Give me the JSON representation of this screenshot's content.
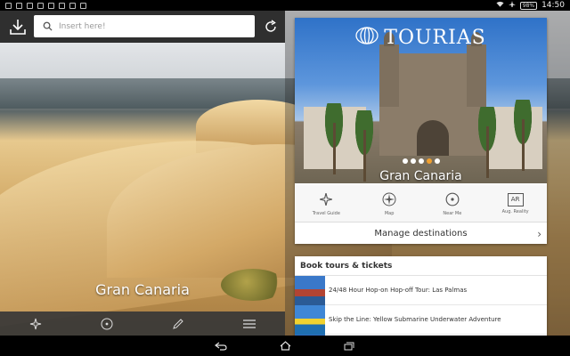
{
  "status_bar": {
    "battery": "98%",
    "time": "14:50"
  },
  "search": {
    "placeholder": "Insert here!"
  },
  "destination": {
    "name": "Gran Canaria"
  },
  "card": {
    "brand": "TOURIAS",
    "title": "Gran Canaria",
    "carousel_pages": 5,
    "carousel_active_index": 3,
    "features": [
      {
        "label": "Travel Guide",
        "icon": "star-icon"
      },
      {
        "label": "Map",
        "icon": "compass-icon"
      },
      {
        "label": "Near Me",
        "icon": "target-icon"
      },
      {
        "label": "Aug. Reality",
        "icon": "ar-icon",
        "icon_text": "AR"
      }
    ],
    "manage_label": "Manage destinations"
  },
  "tours": {
    "heading": "Book tours & tickets",
    "items": [
      {
        "label": "24/48 Hour Hop-on Hop-off Tour: Las Palmas"
      },
      {
        "label": "Skip the Line: Yellow Submarine Underwater Adventure"
      },
      {
        "label": ""
      }
    ]
  },
  "bottom_toolbar": [
    "star-icon",
    "target-icon",
    "pencil-icon",
    "menu-icon"
  ],
  "colors": {
    "accent": "#f0a030",
    "topbar": "#2f2f2f"
  }
}
